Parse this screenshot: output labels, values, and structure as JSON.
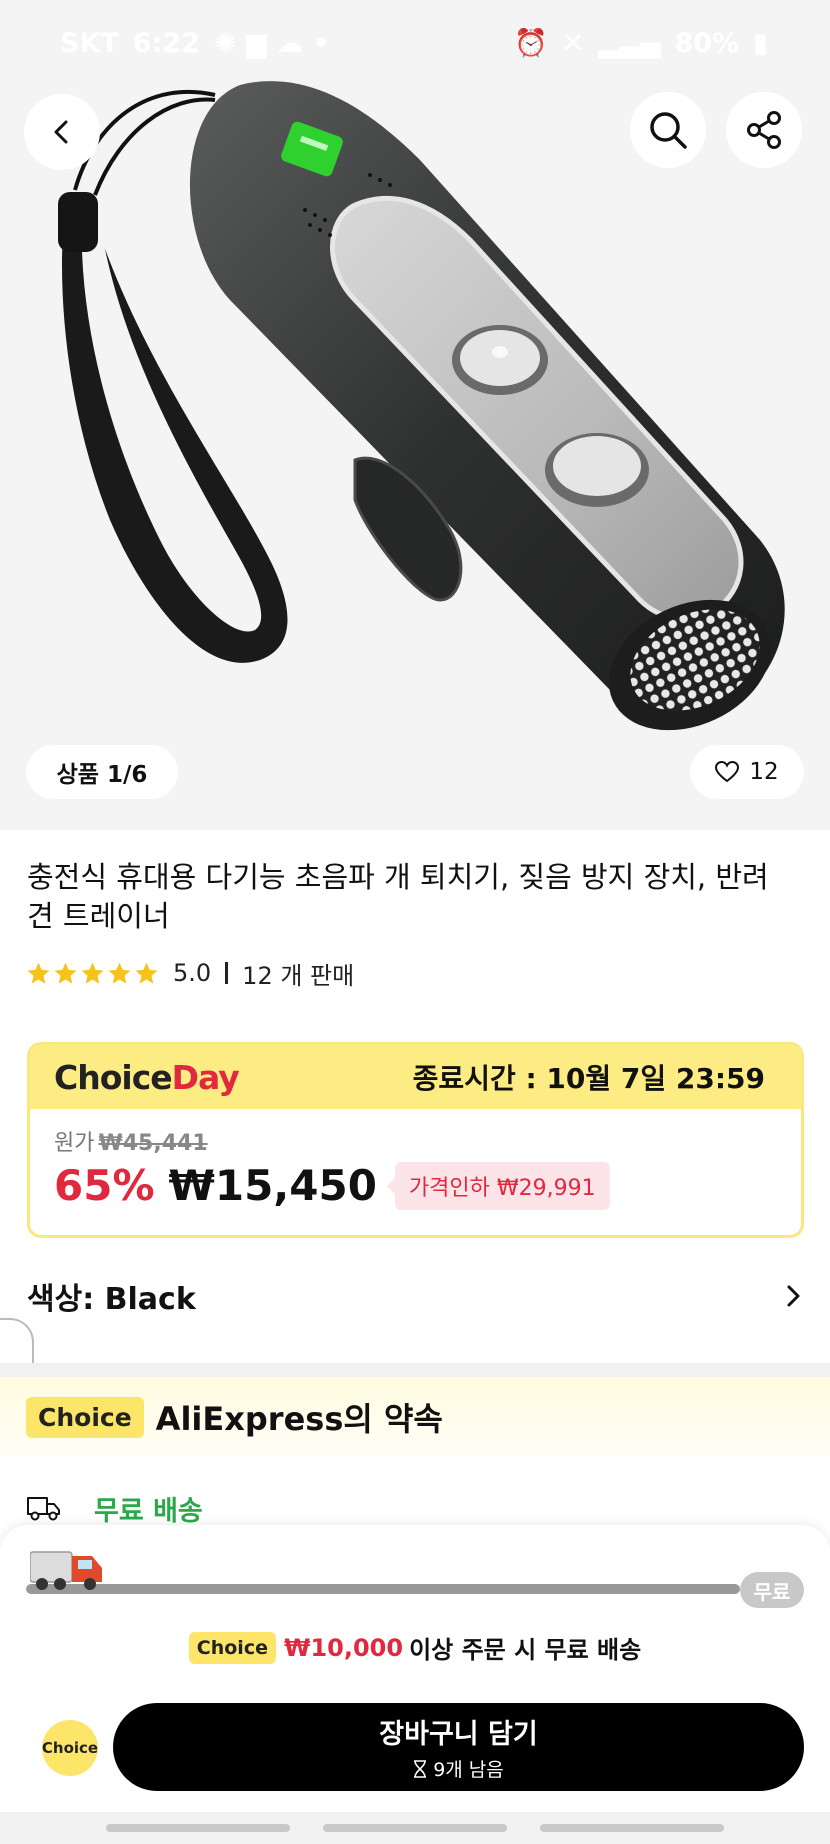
{
  "status_bar": {
    "carrier": "SKT",
    "time": "6:22",
    "battery": "80%"
  },
  "gallery": {
    "counter": "상품 1/6",
    "likes": "12"
  },
  "product": {
    "title": "충전식 휴대용 다기능 초음파 개 퇴치기, 짖음 방지 장치, 반려견 트레이너",
    "rating": "5.0",
    "rating_stars": 5,
    "sold": "12 개 판매"
  },
  "choice_day": {
    "logo_choice": "Choice",
    "logo_day": "Day",
    "end_time": "종료시간 :  10월 7일 23:59",
    "original_label": "원가",
    "original_price": "₩45,441",
    "discount": "65%",
    "price": "₩15,450",
    "price_drop": "가격인하 ₩29,991"
  },
  "color_option": {
    "label": "색상: Black"
  },
  "promise": {
    "badge": "Choice",
    "title": "AliExpress의 약속"
  },
  "free_shipping": {
    "label": "무료 배송",
    "progress_pill": "무료",
    "progress": 0.08,
    "badge": "Choice",
    "amount": "₩10,000",
    "message": "이상 주문 시 무료 배송"
  },
  "cart": {
    "choice_icon_label": "Choice",
    "button_label": "장바구니 담기",
    "stock": "9개 남음"
  },
  "colors": {
    "accent_red": "#e0293e",
    "choice_yellow": "#fde56a",
    "free_green": "#2aa84a"
  }
}
